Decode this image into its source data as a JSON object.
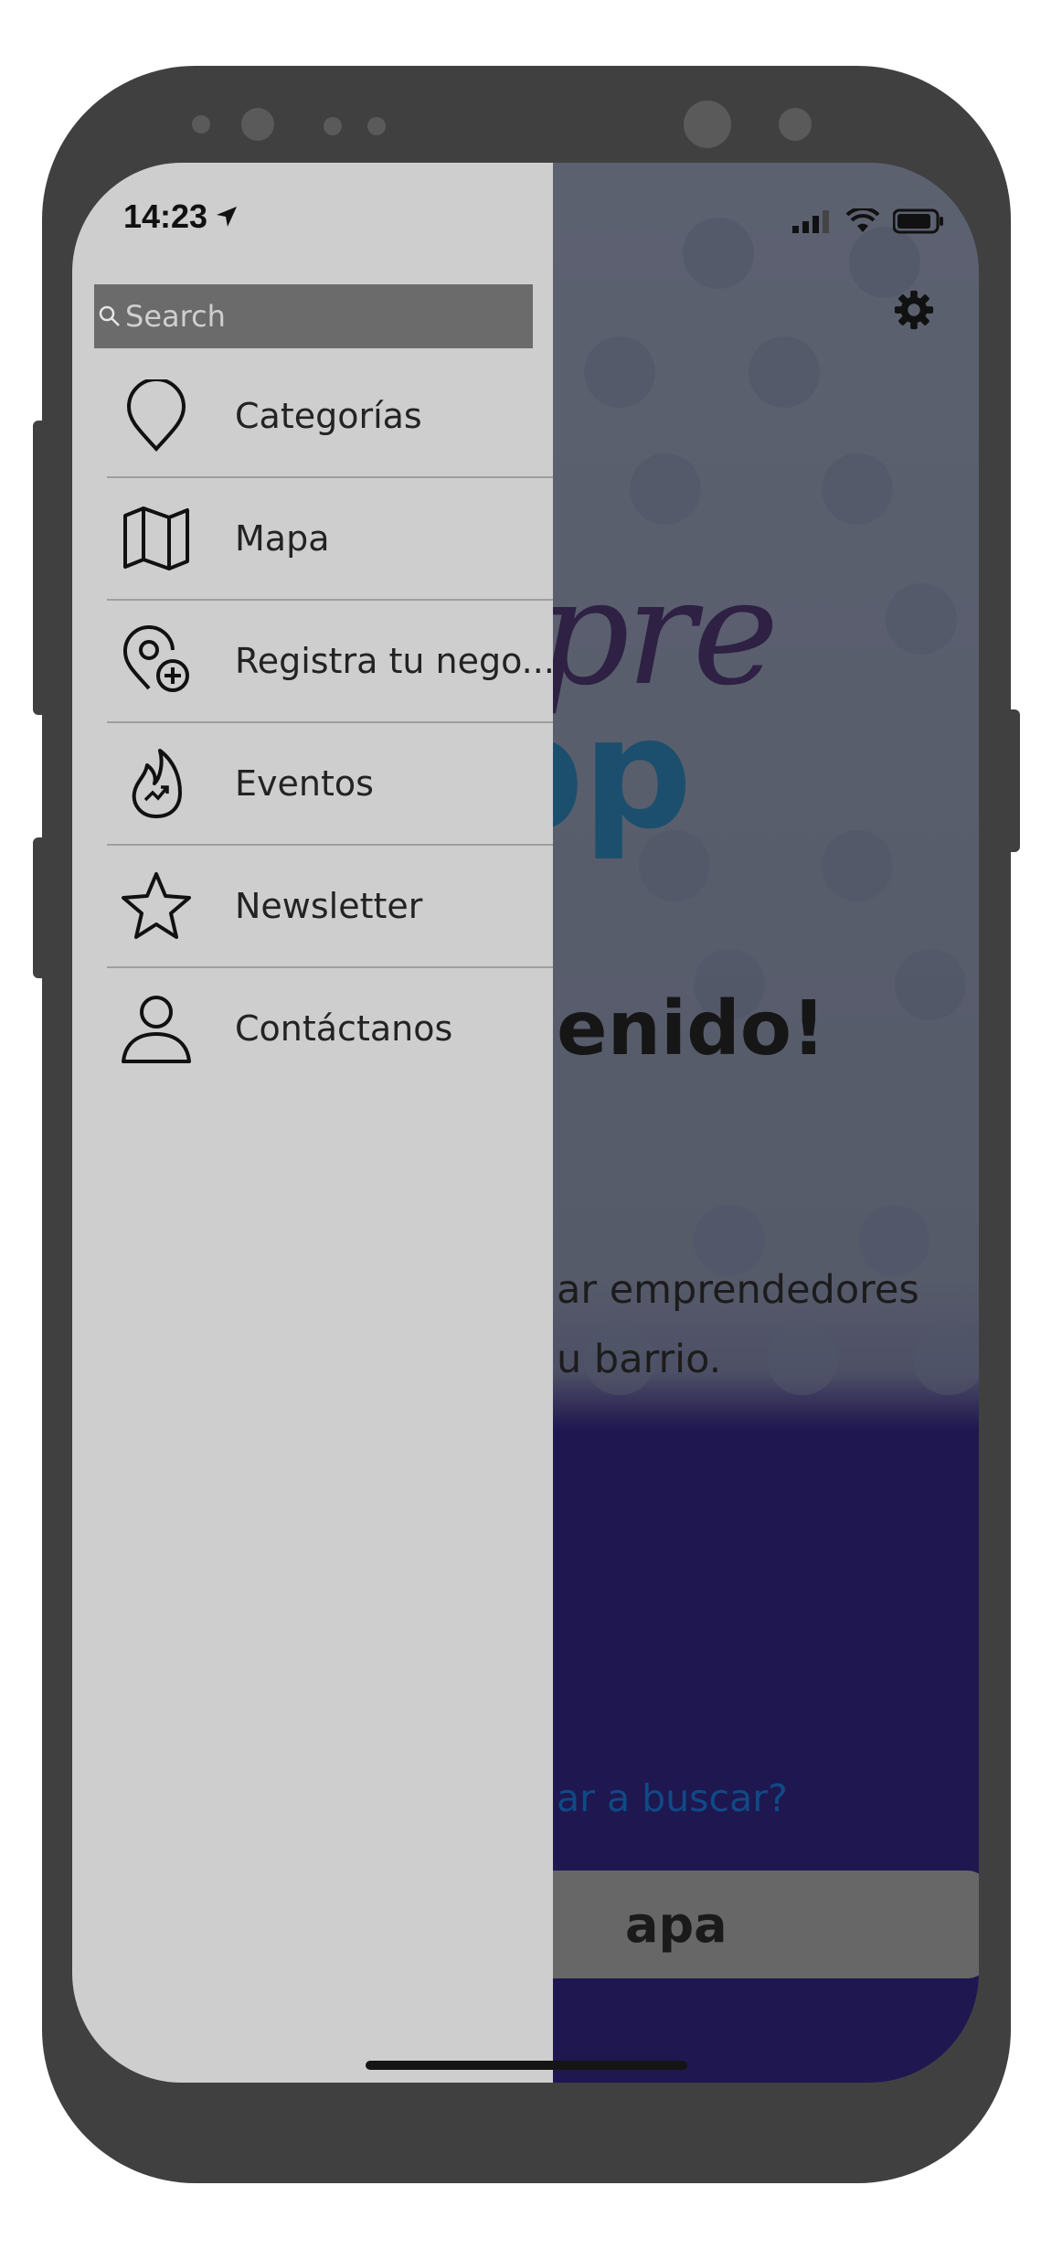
{
  "status_bar": {
    "time": "14:23"
  },
  "drawer": {
    "search": {
      "placeholder": "Search",
      "value": ""
    },
    "items": [
      {
        "label": "Categorías",
        "icon": "map-pin-icon"
      },
      {
        "label": "Mapa",
        "icon": "map-icon"
      },
      {
        "label": "Registra tu nego...",
        "icon": "add-location-icon"
      },
      {
        "label": "Eventos",
        "icon": "flame-icon"
      },
      {
        "label": "Newsletter",
        "icon": "star-icon"
      },
      {
        "label": "Contáctanos",
        "icon": "user-icon"
      }
    ]
  },
  "background_app": {
    "brand_line1": "mpre",
    "brand_line2": "pp",
    "welcome_title": "enido!",
    "welcome_text_line1": "ar emprendedores",
    "welcome_text_line2": "u barrio.",
    "cta_question": "ar a buscar?",
    "map_button_label": "apa",
    "colors": {
      "brand_purple": "#2e2144",
      "brand_teal": "#1c4f6e",
      "bottom_panel": "#1f1750"
    }
  },
  "colors": {
    "phone_frame": "#404040",
    "drawer_bg": "#cecece",
    "search_bg": "#6b6b6b"
  }
}
